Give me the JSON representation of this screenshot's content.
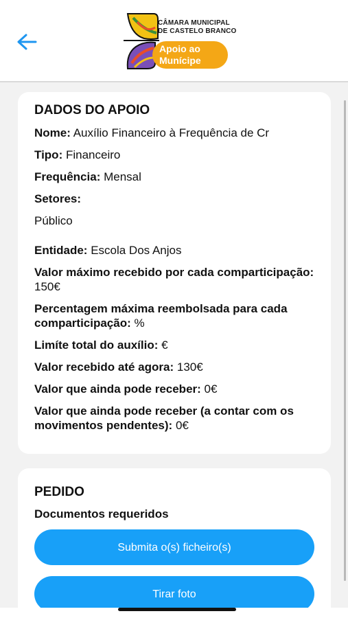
{
  "header": {
    "org_name": "Câmara Municipal de Castelo Branco",
    "app_name_line1": "Apoio ao",
    "app_name_line2": "Munícipe",
    "accent": "#f4a716",
    "back_icon": "arrow-left-icon"
  },
  "apoio": {
    "title": "DADOS DO APOIO",
    "nome_label": "Nome:",
    "nome_value": "Auxílio Financeiro à Frequência de Cr",
    "tipo_label": "Tipo:",
    "tipo_value": "Financeiro",
    "frequencia_label": "Frequência:",
    "frequencia_value": "Mensal",
    "setores_label": "Setores:",
    "setores_value": "Público",
    "entidade_label": "Entidade:",
    "entidade_value": "Escola Dos Anjos",
    "valor_max_label": "Valor máximo recebido por cada comparticipação:",
    "valor_max_value": "150€",
    "percentagem_label": "Percentagem máxima reembolsada para cada comparticipação:",
    "percentagem_value": "%",
    "limite_label": "Limíte total do auxílio:",
    "limite_value": "€",
    "recebido_label": "Valor recebido até agora:",
    "recebido_value": "130€",
    "pode_receber_label": "Valor que ainda pode receber:",
    "pode_receber_value": "0€",
    "pode_receber_pend_label": "Valor que ainda pode receber (a contar com os movimentos pendentes):",
    "pode_receber_pend_value": "0€"
  },
  "pedido": {
    "title": "PEDIDO",
    "subtitle": "Documentos requeridos",
    "submit_label": "Submita o(s) ficheiro(s)",
    "photo_label": "Tirar foto",
    "button_color": "#18a0f8"
  }
}
